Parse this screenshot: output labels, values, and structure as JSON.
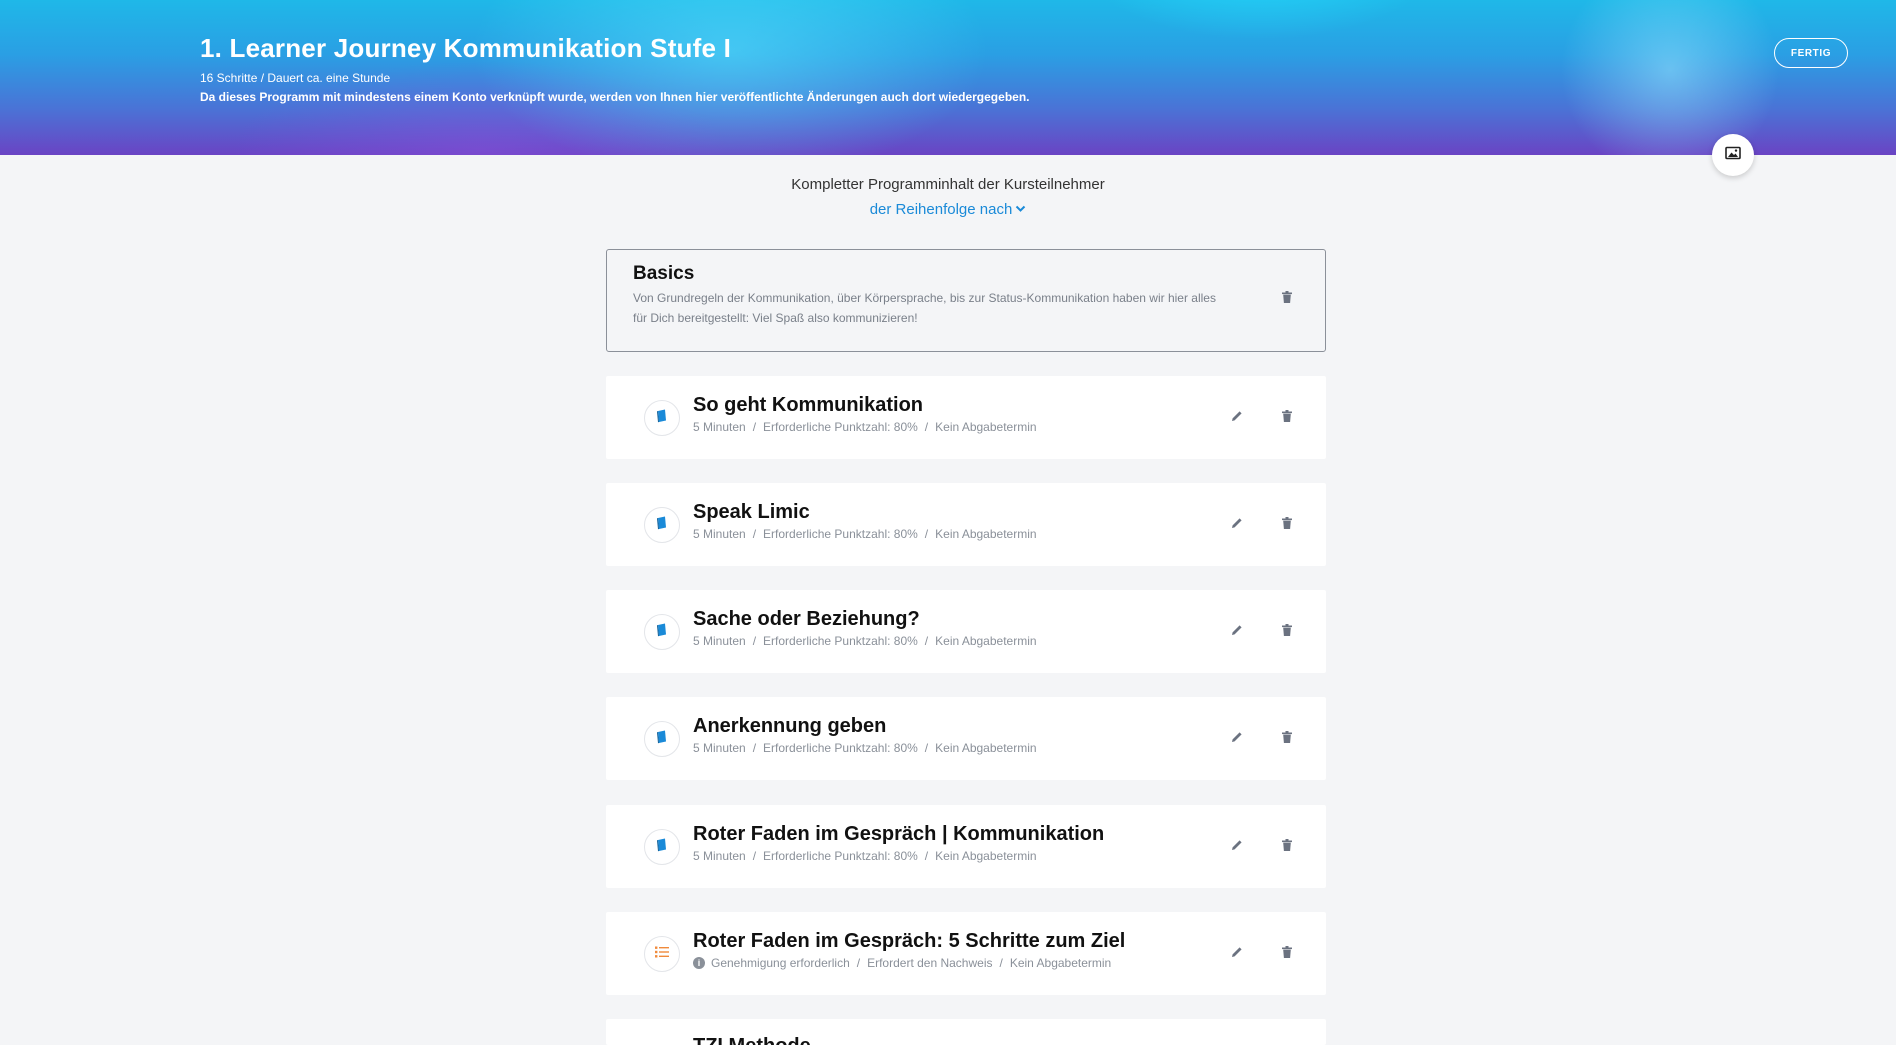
{
  "header": {
    "title": "1. Learner Journey Kommunikation Stufe I",
    "subtitle": "16 Schritte / Dauert ca. eine Stunde",
    "note": "Da dieses Programm mit mindestens einem Konto verknüpft wurde, werden von Ihnen hier veröffentlichte Änderungen auch dort wiedergegeben.",
    "done_label": "FERTIG"
  },
  "content": {
    "heading": "Kompletter Programminhalt der Kursteilnehmer",
    "sort_label": "der Reihenfolge nach"
  },
  "section": {
    "title": "Basics",
    "description": "Von Grundregeln der Kommunikation, über Körpersprache, bis zur Status-Kommunikation haben wir hier alles für Dich bereitgestellt: Viel Spaß also kommunizieren!"
  },
  "steps": [
    {
      "title": "So geht Kommunikation",
      "icon": "book-icon",
      "meta": [
        "5 Minuten",
        "Erforderliche Punktzahl: 80%",
        "Kein Abgabetermin"
      ]
    },
    {
      "title": "Speak Limic",
      "icon": "book-icon",
      "meta": [
        "5 Minuten",
        "Erforderliche Punktzahl: 80%",
        "Kein Abgabetermin"
      ]
    },
    {
      "title": "Sache oder Beziehung?",
      "icon": "book-icon",
      "meta": [
        "5 Minuten",
        "Erforderliche Punktzahl: 80%",
        "Kein Abgabetermin"
      ]
    },
    {
      "title": "Anerkennung geben",
      "icon": "book-icon",
      "meta": [
        "5 Minuten",
        "Erforderliche Punktzahl: 80%",
        "Kein Abgabetermin"
      ]
    },
    {
      "title": "Roter Faden im Gespräch | Kommunikation",
      "icon": "book-icon",
      "meta": [
        "5 Minuten",
        "Erforderliche Punktzahl: 80%",
        "Kein Abgabetermin"
      ]
    },
    {
      "title": "Roter Faden im Gespräch: 5 Schritte zum Ziel",
      "icon": "checklist-icon",
      "meta": [
        "Genehmigung erforderlich",
        "Erfordert den Nachweis",
        "Kein Abgabetermin"
      ]
    },
    {
      "title": "TZI Methode",
      "icon": "book-icon",
      "meta": []
    }
  ],
  "colors": {
    "accent": "#1a8ad8",
    "book_icon": "#1a8ad8",
    "checklist_icon": "#f08a3c",
    "banner_top": "#1fb8e8",
    "banner_bottom": "#6a44c4"
  }
}
